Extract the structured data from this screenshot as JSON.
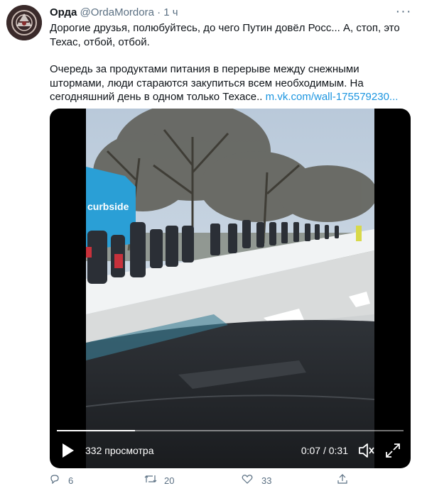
{
  "tweet": {
    "display_name": "Орда",
    "handle": "@OrdaMordora",
    "separator": "·",
    "time": "1 ч",
    "more_glyph": "···",
    "text_line1": "Дорогие друзья, полюбуйтесь, до чего Путин довёл Росс... А, стоп, это Техас, отбой, отбой.",
    "text_para2": "Очередь за продуктами питания в перерыве между снежными штормами, люди стараются закупиться всем необходимым. На сегодняшний день в одном только Техасе..",
    "link": "m.vk.com/wall-175579230..."
  },
  "video": {
    "views": "332 просмотра",
    "timecode": "0:07 / 0:31",
    "progress": 0.226,
    "truck_sign": "curbside"
  },
  "actions": {
    "replies": "6",
    "retweets": "20",
    "likes": "33"
  },
  "colors": {
    "link": "#1b95e0",
    "secondary_text": "#5b7083",
    "truck": "#2a9fd6"
  }
}
